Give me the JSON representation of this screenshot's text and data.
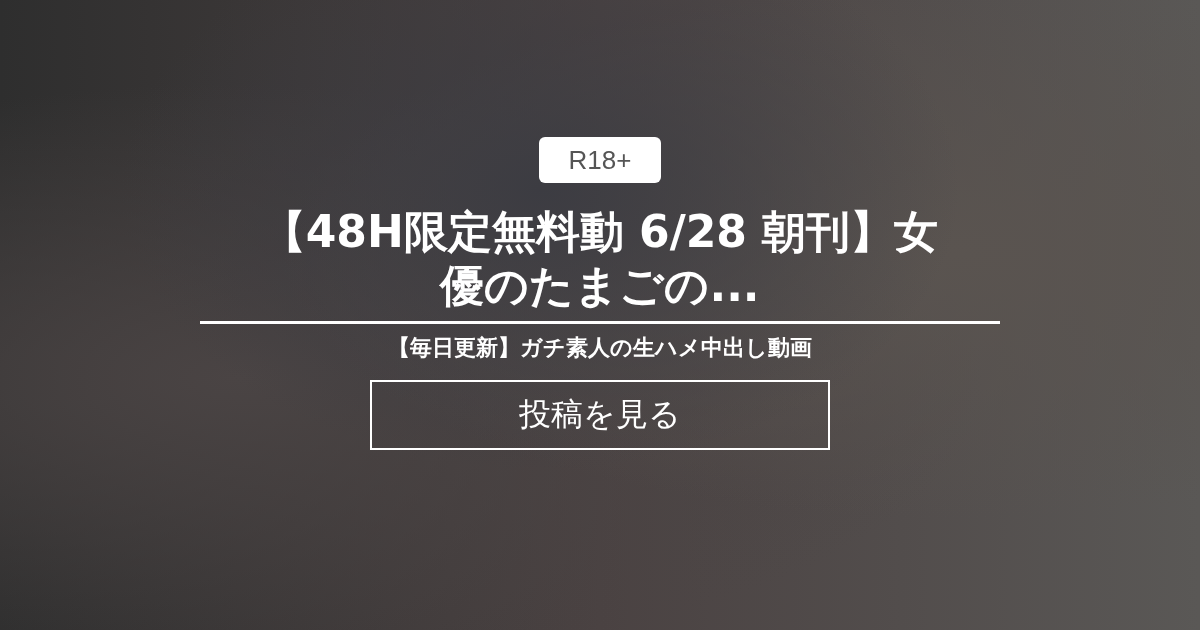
{
  "badge": "R18+",
  "title": "【48H限定無料動 6/28 朝刊】女優のたまごの...",
  "subtitle": "【毎日更新】ガチ素人の生ハメ中出し動画",
  "button": "投稿を見る"
}
